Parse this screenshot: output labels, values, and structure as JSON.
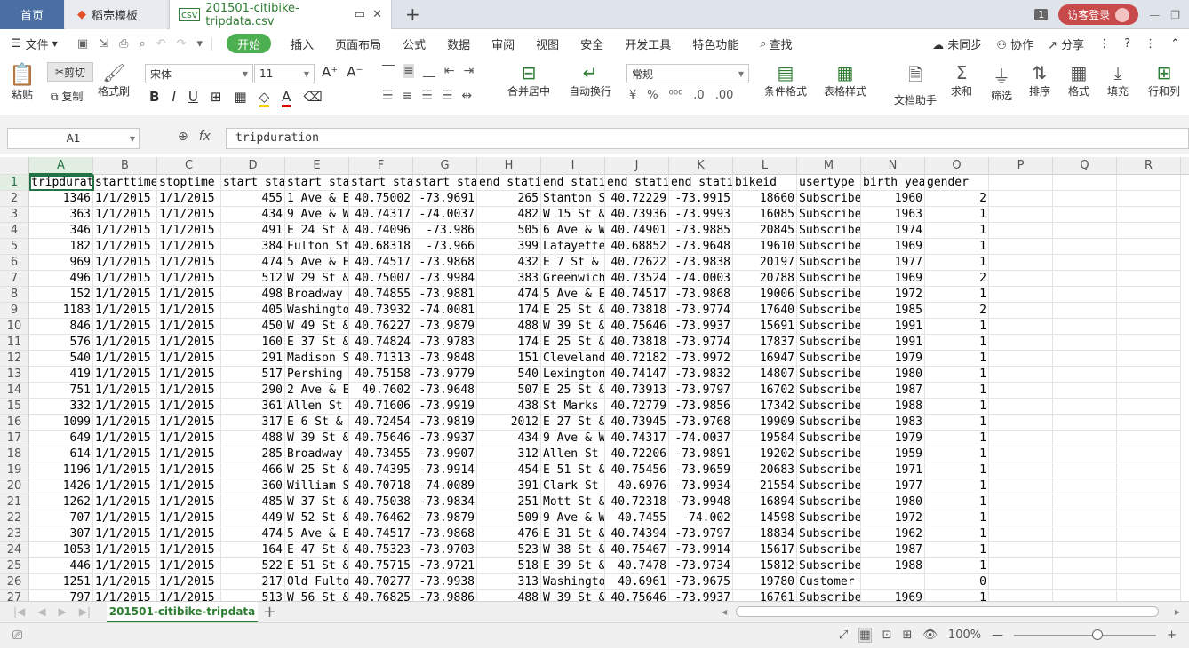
{
  "titlebar": {
    "tabs": [
      "首页",
      "稻壳模板",
      "201501-citibike-tripdata.csv"
    ],
    "badge": "1",
    "login_label": "访客登录"
  },
  "menu": {
    "file": "文件",
    "items": [
      "开始",
      "插入",
      "页面布局",
      "公式",
      "数据",
      "审阅",
      "视图",
      "安全",
      "开发工具",
      "特色功能"
    ],
    "search": "查找",
    "sync": "未同步",
    "collab": "协作",
    "share": "分享"
  },
  "ribbon": {
    "paste": "粘贴",
    "cut": "剪切",
    "copy": "复制",
    "format_painter": "格式刷",
    "font_name": "宋体",
    "font_size": "11",
    "merge": "合并居中",
    "wrap": "自动换行",
    "number_format": "常规",
    "cond_format": "条件格式",
    "table_style": "表格样式",
    "doc_helper": "文档助手",
    "sum": "求和",
    "filter": "筛选",
    "sort": "排序",
    "format": "格式",
    "fill": "填充",
    "rowcol": "行和列"
  },
  "formula_bar": {
    "cell_ref": "A1",
    "value": "tripduration"
  },
  "columns": [
    "A",
    "B",
    "C",
    "D",
    "E",
    "F",
    "G",
    "H",
    "I",
    "J",
    "K",
    "L",
    "M",
    "N",
    "O",
    "P",
    "Q",
    "R"
  ],
  "rows": [
    [
      "tripdurat",
      "starttime",
      "stoptime",
      "start sta",
      "start sta",
      "start sta",
      "start sta",
      "end stati",
      "end stati",
      "end stati",
      "end stati",
      "bikeid",
      "usertype",
      "birth yea",
      "gender"
    ],
    [
      "1346",
      "1/1/2015",
      "1/1/2015",
      "455",
      "1 Ave & E",
      "40.75002",
      "-73.9691",
      "265",
      "Stanton S",
      "40.72229",
      "-73.9915",
      "18660",
      "Subscribe",
      "1960",
      "2"
    ],
    [
      "363",
      "1/1/2015",
      "1/1/2015",
      "434",
      "9 Ave & W",
      "40.74317",
      "-74.0037",
      "482",
      "W 15 St &",
      "40.73936",
      "-73.9993",
      "16085",
      "Subscribe",
      "1963",
      "1"
    ],
    [
      "346",
      "1/1/2015",
      "1/1/2015",
      "491",
      "E 24 St &",
      "40.74096",
      "-73.986",
      "505",
      "6 Ave & W",
      "40.74901",
      "-73.9885",
      "20845",
      "Subscribe",
      "1974",
      "1"
    ],
    [
      "182",
      "1/1/2015",
      "1/1/2015",
      "384",
      "Fulton St",
      "40.68318",
      "-73.966",
      "399",
      "Lafayette",
      "40.68852",
      "-73.9648",
      "19610",
      "Subscribe",
      "1969",
      "1"
    ],
    [
      "969",
      "1/1/2015",
      "1/1/2015",
      "474",
      "5 Ave & E",
      "40.74517",
      "-73.9868",
      "432",
      "E 7 St &",
      "40.72622",
      "-73.9838",
      "20197",
      "Subscribe",
      "1977",
      "1"
    ],
    [
      "496",
      "1/1/2015",
      "1/1/2015",
      "512",
      "W 29 St &",
      "40.75007",
      "-73.9984",
      "383",
      "Greenwich",
      "40.73524",
      "-74.0003",
      "20788",
      "Subscribe",
      "1969",
      "2"
    ],
    [
      "152",
      "1/1/2015",
      "1/1/2015",
      "498",
      "Broadway",
      "40.74855",
      "-73.9881",
      "474",
      "5 Ave & E",
      "40.74517",
      "-73.9868",
      "19006",
      "Subscribe",
      "1972",
      "1"
    ],
    [
      "1183",
      "1/1/2015",
      "1/1/2015",
      "405",
      "Washingto",
      "40.73932",
      "-74.0081",
      "174",
      "E 25 St &",
      "40.73818",
      "-73.9774",
      "17640",
      "Subscribe",
      "1985",
      "2"
    ],
    [
      "846",
      "1/1/2015",
      "1/1/2015",
      "450",
      "W 49 St &",
      "40.76227",
      "-73.9879",
      "488",
      "W 39 St &",
      "40.75646",
      "-73.9937",
      "15691",
      "Subscribe",
      "1991",
      "1"
    ],
    [
      "576",
      "1/1/2015",
      "1/1/2015",
      "160",
      "E 37 St &",
      "40.74824",
      "-73.9783",
      "174",
      "E 25 St &",
      "40.73818",
      "-73.9774",
      "17837",
      "Subscribe",
      "1991",
      "1"
    ],
    [
      "540",
      "1/1/2015",
      "1/1/2015",
      "291",
      "Madison S",
      "40.71313",
      "-73.9848",
      "151",
      "Cleveland",
      "40.72182",
      "-73.9972",
      "16947",
      "Subscribe",
      "1979",
      "1"
    ],
    [
      "419",
      "1/1/2015",
      "1/1/2015",
      "517",
      "Pershing",
      "40.75158",
      "-73.9779",
      "540",
      "Lexington",
      "40.74147",
      "-73.9832",
      "14807",
      "Subscribe",
      "1980",
      "1"
    ],
    [
      "751",
      "1/1/2015",
      "1/1/2015",
      "290",
      "2 Ave & E",
      "40.7602",
      "-73.9648",
      "507",
      "E 25 St &",
      "40.73913",
      "-73.9797",
      "16702",
      "Subscribe",
      "1987",
      "1"
    ],
    [
      "332",
      "1/1/2015",
      "1/1/2015",
      "361",
      "Allen St",
      "40.71606",
      "-73.9919",
      "438",
      "St Marks",
      "40.72779",
      "-73.9856",
      "17342",
      "Subscribe",
      "1988",
      "1"
    ],
    [
      "1099",
      "1/1/2015",
      "1/1/2015",
      "317",
      "E 6 St &",
      "40.72454",
      "-73.9819",
      "2012",
      "E 27 St &",
      "40.73945",
      "-73.9768",
      "19909",
      "Subscribe",
      "1983",
      "1"
    ],
    [
      "649",
      "1/1/2015",
      "1/1/2015",
      "488",
      "W 39 St &",
      "40.75646",
      "-73.9937",
      "434",
      "9 Ave & W",
      "40.74317",
      "-74.0037",
      "19584",
      "Subscribe",
      "1979",
      "1"
    ],
    [
      "614",
      "1/1/2015",
      "1/1/2015",
      "285",
      "Broadway",
      "40.73455",
      "-73.9907",
      "312",
      "Allen St",
      "40.72206",
      "-73.9891",
      "19202",
      "Subscribe",
      "1959",
      "1"
    ],
    [
      "1196",
      "1/1/2015",
      "1/1/2015",
      "466",
      "W 25 St &",
      "40.74395",
      "-73.9914",
      "454",
      "E 51 St &",
      "40.75456",
      "-73.9659",
      "20683",
      "Subscribe",
      "1971",
      "1"
    ],
    [
      "1426",
      "1/1/2015",
      "1/1/2015",
      "360",
      "William S",
      "40.70718",
      "-74.0089",
      "391",
      "Clark St",
      "40.6976",
      "-73.9934",
      "21554",
      "Subscribe",
      "1977",
      "1"
    ],
    [
      "1262",
      "1/1/2015",
      "1/1/2015",
      "485",
      "W 37 St &",
      "40.75038",
      "-73.9834",
      "251",
      "Mott St &",
      "40.72318",
      "-73.9948",
      "16894",
      "Subscribe",
      "1980",
      "1"
    ],
    [
      "707",
      "1/1/2015",
      "1/1/2015",
      "449",
      "W 52 St &",
      "40.76462",
      "-73.9879",
      "509",
      "9 Ave & W",
      "40.7455",
      "-74.002",
      "14598",
      "Subscribe",
      "1972",
      "1"
    ],
    [
      "307",
      "1/1/2015",
      "1/1/2015",
      "474",
      "5 Ave & E",
      "40.74517",
      "-73.9868",
      "476",
      "E 31 St &",
      "40.74394",
      "-73.9797",
      "18834",
      "Subscribe",
      "1962",
      "1"
    ],
    [
      "1053",
      "1/1/2015",
      "1/1/2015",
      "164",
      "E 47 St &",
      "40.75323",
      "-73.9703",
      "523",
      "W 38 St &",
      "40.75467",
      "-73.9914",
      "15617",
      "Subscribe",
      "1987",
      "1"
    ],
    [
      "446",
      "1/1/2015",
      "1/1/2015",
      "522",
      "E 51 St &",
      "40.75715",
      "-73.9721",
      "518",
      "E 39 St &",
      "40.7478",
      "-73.9734",
      "15812",
      "Subscribe",
      "1988",
      "1"
    ],
    [
      "1251",
      "1/1/2015",
      "1/1/2015",
      "217",
      "Old Fulto",
      "40.70277",
      "-73.9938",
      "313",
      "Washingto",
      "40.6961",
      "-73.9675",
      "19780",
      "Customer",
      "",
      "0"
    ],
    [
      "797",
      "1/1/2015",
      "1/1/2015",
      "513",
      "W 56 St &",
      "40.76825",
      "-73.9886",
      "488",
      "W 39 St &",
      "40.75646",
      "-73.9937",
      "16761",
      "Subscribe",
      "1969",
      "1"
    ]
  ],
  "sheet": {
    "name": "201501-citibike-tripdata"
  },
  "status": {
    "zoom": "100%"
  }
}
